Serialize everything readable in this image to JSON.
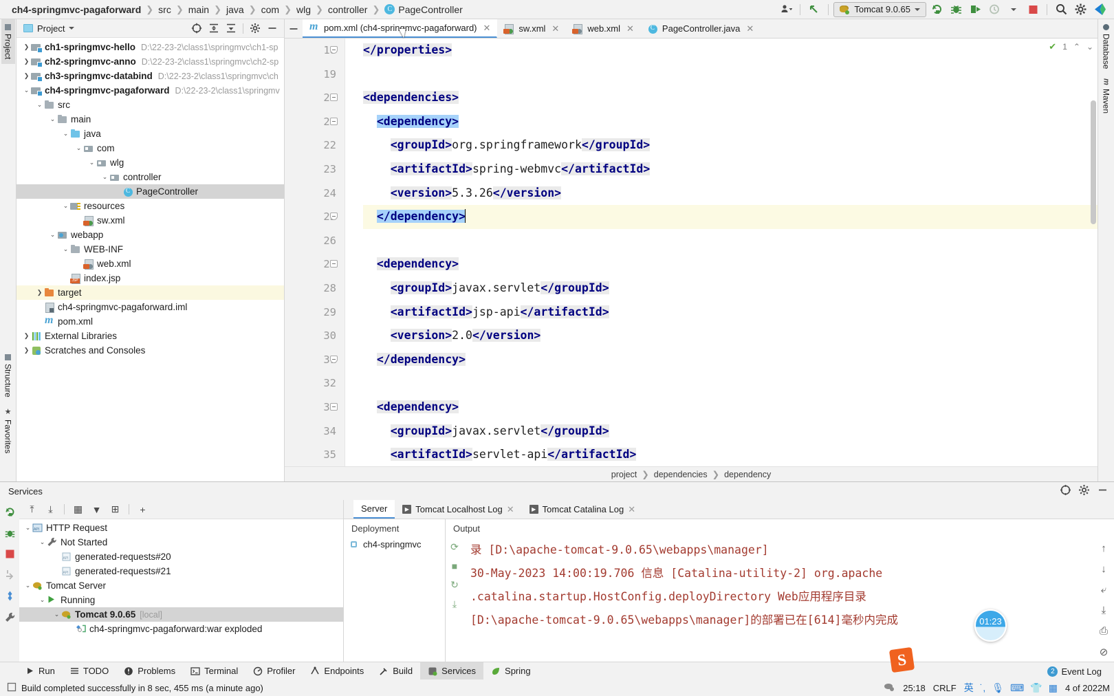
{
  "breadcrumb": {
    "project": "ch4-springmvc-pagaforward",
    "items": [
      "src",
      "main",
      "java",
      "com",
      "wlg",
      "controller"
    ],
    "classFile": "PageController",
    "class_icon": "class-c-icon"
  },
  "toolbar": {
    "profile_icon": "user-profile-icon",
    "updates_icon": "arrow-up-left-icon",
    "run_config": "Tomcat 9.0.65",
    "run_config_icon": "tomcat-icon",
    "dropdown_icon": "chevron-down-icon",
    "rerun_icon": "rerun-icon",
    "debug_icon": "debug-bug-icon",
    "run_with_coverage_icon": "run-with-coverage-icon",
    "profiler_icon": "profiler-clock-icon",
    "stop_icon": "stop-square-icon",
    "search_icon": "search-magnifier-icon",
    "settings_icon": "gear-icon",
    "ide_logo_icon": "intellij-logo-icon"
  },
  "left_strip": {
    "project_tab": "Project",
    "structure_tab": "Structure",
    "favorites_tab": "Favorites",
    "project_icon": "folder-icon",
    "structure_icon": "structure-icon",
    "favorites_icon": "star-icon"
  },
  "right_strip": {
    "database_tab": "Database",
    "maven_tab": "Maven",
    "database_icon": "database-icon",
    "maven_icon": "maven-m-icon"
  },
  "project_panel": {
    "title": "Project",
    "title_icon": "project-view-icon",
    "dropdown_icon": "chevron-down-icon",
    "actions": [
      {
        "name": "select-opened-file-icon",
        "glyph": "⊕"
      },
      {
        "name": "expand-all-icon",
        "glyph": "⤒"
      },
      {
        "name": "collapse-all-icon",
        "glyph": "⤓"
      },
      {
        "name": "settings-gear-icon",
        "glyph": "✿"
      },
      {
        "name": "hide-panel-icon",
        "glyph": "—"
      }
    ],
    "tree": [
      {
        "label": "ch1-springmvc-hello",
        "path": "D:\\22-23-2\\class1\\springmvc\\ch1-sp",
        "indent": 0,
        "arrow": "collapsed",
        "icon": "module-folder-icon",
        "bold": true
      },
      {
        "label": "ch2-springmvc-anno",
        "path": "D:\\22-23-2\\class1\\springmvc\\ch2-sp",
        "indent": 0,
        "arrow": "collapsed",
        "icon": "module-folder-icon",
        "bold": true
      },
      {
        "label": "ch3-springmvc-databind",
        "path": "D:\\22-23-2\\class1\\springmvc\\ch",
        "indent": 0,
        "arrow": "collapsed",
        "icon": "module-folder-icon",
        "bold": true
      },
      {
        "label": "ch4-springmvc-pagaforward",
        "path": "D:\\22-23-2\\class1\\springmv",
        "indent": 0,
        "arrow": "expanded",
        "icon": "module-folder-icon",
        "bold": true
      },
      {
        "label": "src",
        "path": "",
        "indent": 1,
        "arrow": "expanded",
        "icon": "folder-icon",
        "bold": false
      },
      {
        "label": "main",
        "path": "",
        "indent": 2,
        "arrow": "expanded",
        "icon": "folder-icon",
        "bold": false
      },
      {
        "label": "java",
        "path": "",
        "indent": 3,
        "arrow": "expanded",
        "icon": "source-root-icon",
        "bold": false
      },
      {
        "label": "com",
        "path": "",
        "indent": 4,
        "arrow": "expanded",
        "icon": "package-icon",
        "bold": false
      },
      {
        "label": "wlg",
        "path": "",
        "indent": 5,
        "arrow": "expanded",
        "icon": "package-icon",
        "bold": false
      },
      {
        "label": "controller",
        "path": "",
        "indent": 6,
        "arrow": "expanded",
        "icon": "package-icon",
        "bold": false
      },
      {
        "label": "PageController",
        "path": "",
        "indent": 7,
        "arrow": "none",
        "icon": "java-class-icon",
        "bold": false,
        "selected": true
      },
      {
        "label": "resources",
        "path": "",
        "indent": 3,
        "arrow": "expanded",
        "icon": "resources-root-icon",
        "bold": false
      },
      {
        "label": "sw.xml",
        "path": "",
        "indent": 4,
        "arrow": "none",
        "icon": "xml-file-icon",
        "bold": false
      },
      {
        "label": "webapp",
        "path": "",
        "indent": 2,
        "arrow": "expanded",
        "icon": "webapp-folder-icon",
        "bold": false
      },
      {
        "label": "WEB-INF",
        "path": "",
        "indent": 3,
        "arrow": "expanded",
        "icon": "folder-icon",
        "bold": false
      },
      {
        "label": "web.xml",
        "path": "",
        "indent": 4,
        "arrow": "none",
        "icon": "xml-file-icon",
        "bold": false
      },
      {
        "label": "index.jsp",
        "path": "",
        "indent": 3,
        "arrow": "none",
        "icon": "jsp-file-icon",
        "bold": false
      },
      {
        "label": "target",
        "path": "",
        "indent": 1,
        "arrow": "collapsed",
        "icon": "target-folder-icon",
        "bold": false,
        "highlight": true
      },
      {
        "label": "ch4-springmvc-pagaforward.iml",
        "path": "",
        "indent": 1,
        "arrow": "none",
        "icon": "iml-file-icon",
        "bold": false
      },
      {
        "label": "pom.xml",
        "path": "",
        "indent": 1,
        "arrow": "none",
        "icon": "maven-pom-icon",
        "bold": false
      },
      {
        "label": "External Libraries",
        "path": "",
        "indent": 0,
        "arrow": "collapsed",
        "icon": "libraries-icon",
        "bold": false
      },
      {
        "label": "Scratches and Consoles",
        "path": "",
        "indent": 0,
        "arrow": "collapsed",
        "icon": "scratches-icon",
        "bold": false
      }
    ]
  },
  "editor": {
    "collapse_icon": "hide-tabs-icon",
    "tabs": [
      {
        "label": "pom.xml (ch4-springmvc-pagaforward)",
        "icon": "maven-pom-icon",
        "active": true,
        "close_icon": "close-icon"
      },
      {
        "label": "sw.xml",
        "icon": "xml-file-icon",
        "active": false,
        "close_icon": "close-icon"
      },
      {
        "label": "web.xml",
        "icon": "xml-file-icon",
        "active": false,
        "close_icon": "close-icon"
      },
      {
        "label": "PageController.java",
        "icon": "java-class-icon",
        "active": false,
        "close_icon": "close-icon"
      }
    ],
    "inspection": {
      "count": "1",
      "check_icon": "inspection-check-icon",
      "prev_icon": "chevron-up-icon",
      "next_icon": "chevron-down-icon"
    },
    "first_line_number": 18,
    "lines": [
      {
        "num": 18,
        "indent": 0,
        "fold": "end",
        "current": false,
        "parts": [
          {
            "t": "</properties>",
            "k": "tag",
            "bg": "hl"
          }
        ]
      },
      {
        "num": 19,
        "indent": 0,
        "fold": "",
        "current": false,
        "parts": []
      },
      {
        "num": 20,
        "indent": 0,
        "fold": "start",
        "current": false,
        "parts": [
          {
            "t": "<dependencies>",
            "k": "tag",
            "bg": "hl"
          }
        ]
      },
      {
        "num": 21,
        "indent": 1,
        "fold": "start",
        "current": false,
        "parts": [
          {
            "t": "<dependency>",
            "k": "tag",
            "bg": "sel"
          }
        ]
      },
      {
        "num": 22,
        "indent": 2,
        "fold": "",
        "current": false,
        "parts": [
          {
            "t": "<groupId>",
            "k": "tag",
            "bg": "hl"
          },
          {
            "t": "org.springframework",
            "k": "txt",
            "bg": ""
          },
          {
            "t": "</groupId>",
            "k": "tag",
            "bg": "hl"
          }
        ]
      },
      {
        "num": 23,
        "indent": 2,
        "fold": "",
        "current": false,
        "parts": [
          {
            "t": "<artifactId>",
            "k": "tag",
            "bg": "hl"
          },
          {
            "t": "spring-webmvc",
            "k": "txt",
            "bg": ""
          },
          {
            "t": "</artifactId>",
            "k": "tag",
            "bg": "hl"
          }
        ]
      },
      {
        "num": 24,
        "indent": 2,
        "fold": "",
        "current": false,
        "parts": [
          {
            "t": "<version>",
            "k": "tag",
            "bg": "hl"
          },
          {
            "t": "5.3.26",
            "k": "txt",
            "bg": ""
          },
          {
            "t": "</version>",
            "k": "tag",
            "bg": "hl"
          }
        ]
      },
      {
        "num": 25,
        "indent": 1,
        "fold": "end",
        "current": true,
        "parts": [
          {
            "t": "</dependency>",
            "k": "tag",
            "bg": "sel"
          }
        ],
        "caret": true
      },
      {
        "num": 26,
        "indent": 0,
        "fold": "",
        "current": false,
        "parts": []
      },
      {
        "num": 27,
        "indent": 1,
        "fold": "start",
        "current": false,
        "parts": [
          {
            "t": "<dependency>",
            "k": "tag",
            "bg": "hl"
          }
        ]
      },
      {
        "num": 28,
        "indent": 2,
        "fold": "",
        "current": false,
        "parts": [
          {
            "t": "<groupId>",
            "k": "tag",
            "bg": "hl"
          },
          {
            "t": "javax.servlet",
            "k": "txt",
            "bg": ""
          },
          {
            "t": "</groupId>",
            "k": "tag",
            "bg": "hl"
          }
        ]
      },
      {
        "num": 29,
        "indent": 2,
        "fold": "",
        "current": false,
        "parts": [
          {
            "t": "<artifactId>",
            "k": "tag",
            "bg": "hl"
          },
          {
            "t": "jsp-api",
            "k": "txt",
            "bg": ""
          },
          {
            "t": "</artifactId>",
            "k": "tag",
            "bg": "hl"
          }
        ]
      },
      {
        "num": 30,
        "indent": 2,
        "fold": "",
        "current": false,
        "parts": [
          {
            "t": "<version>",
            "k": "tag",
            "bg": "hl"
          },
          {
            "t": "2.0",
            "k": "txt",
            "bg": ""
          },
          {
            "t": "</version>",
            "k": "tag",
            "bg": "hl"
          }
        ]
      },
      {
        "num": 31,
        "indent": 1,
        "fold": "end",
        "current": false,
        "parts": [
          {
            "t": "</dependency>",
            "k": "tag",
            "bg": "hl"
          }
        ]
      },
      {
        "num": 32,
        "indent": 0,
        "fold": "",
        "current": false,
        "parts": []
      },
      {
        "num": 33,
        "indent": 1,
        "fold": "start",
        "current": false,
        "parts": [
          {
            "t": "<dependency>",
            "k": "tag",
            "bg": "hl"
          }
        ]
      },
      {
        "num": 34,
        "indent": 2,
        "fold": "",
        "current": false,
        "parts": [
          {
            "t": "<groupId>",
            "k": "tag",
            "bg": "hl"
          },
          {
            "t": "javax.servlet",
            "k": "txt",
            "bg": ""
          },
          {
            "t": "</groupId>",
            "k": "tag",
            "bg": "hl"
          }
        ]
      },
      {
        "num": 35,
        "indent": 2,
        "fold": "",
        "current": false,
        "parts": [
          {
            "t": "<artifactId>",
            "k": "tag",
            "bg": "hl"
          },
          {
            "t": "servlet-api",
            "k": "txt",
            "bg": ""
          },
          {
            "t": "</artifactId>",
            "k": "tag",
            "bg": "hl"
          }
        ]
      }
    ],
    "crumbs": [
      "project",
      "dependencies",
      "dependency"
    ]
  },
  "services": {
    "title": "Services",
    "header_actions": [
      {
        "name": "services-settings-icon",
        "glyph": "⊕"
      },
      {
        "name": "gear-icon",
        "glyph": "✿"
      },
      {
        "name": "hide-panel-icon",
        "glyph": "—"
      }
    ],
    "side_tools": [
      {
        "name": "rerun-service-icon"
      },
      {
        "name": "debug-service-icon"
      },
      {
        "name": "stop-service-icon"
      },
      {
        "name": "redeploy-icon"
      },
      {
        "name": "edit-configuration-icon"
      },
      {
        "name": "settings-wrench-icon"
      }
    ],
    "tree_toolbar": [
      {
        "name": "expand-all-icon",
        "glyph": "⤒"
      },
      {
        "name": "collapse-all-icon",
        "glyph": "⤓"
      },
      {
        "name": "group-by-icon",
        "glyph": "▦"
      },
      {
        "name": "filter-icon",
        "glyph": "▼"
      },
      {
        "name": "show-services-icon",
        "glyph": "⊞"
      },
      {
        "name": "add-service-icon",
        "glyph": "+"
      }
    ],
    "tree": [
      {
        "label": "HTTP Request",
        "indent": 0,
        "arrow": "expanded",
        "icon": "http-request-api-icon",
        "bold": false
      },
      {
        "label": "Not Started",
        "indent": 1,
        "arrow": "expanded",
        "icon": "wrench-icon",
        "bold": false
      },
      {
        "label": "generated-requests#20",
        "indent": 2,
        "arrow": "none",
        "icon": "api-file-icon",
        "bold": false
      },
      {
        "label": "generated-requests#21",
        "indent": 2,
        "arrow": "none",
        "icon": "api-file-icon",
        "bold": false
      },
      {
        "label": "Tomcat Server",
        "indent": 0,
        "arrow": "expanded",
        "icon": "tomcat-icon",
        "bold": false
      },
      {
        "label": "Running",
        "indent": 1,
        "arrow": "expanded",
        "icon": "run-green-arrow-icon",
        "bold": false
      },
      {
        "label": "Tomcat 9.0.65",
        "suffix": "[local]",
        "indent": 2,
        "arrow": "expanded",
        "icon": "tomcat-icon",
        "bold": true,
        "selected": true
      },
      {
        "label": "ch4-springmvc-pagaforward:war exploded",
        "indent": 3,
        "arrow": "none",
        "icon": "artifact-icon",
        "bold": false
      }
    ],
    "tabs": [
      {
        "label": "Server",
        "active": true,
        "icon": "",
        "close": false
      },
      {
        "label": "Tomcat Localhost Log",
        "active": false,
        "icon": "console-icon",
        "close": true
      },
      {
        "label": "Tomcat Catalina Log",
        "active": false,
        "icon": "console-icon",
        "close": true
      }
    ],
    "deployment_header": "Deployment",
    "deployment_items": [
      {
        "label": "ch4-springmvc",
        "icon": "artifact-icon",
        "action_icon": "deploy-icon"
      }
    ],
    "output_header": "Output",
    "output_lines": [
      "录 [D:\\apache-tomcat-9.0.65\\webapps\\manager]",
      "30-May-2023 14:00:19.706 信息 [Catalina-utility-2] org.apache",
      ".catalina.startup.HostConfig.deployDirectory Web应用程序目录",
      "[D:\\apache-tomcat-9.0.65\\webapps\\manager]的部署已在[614]毫秒内完成"
    ],
    "output_tools": [
      {
        "name": "scroll-up-icon",
        "glyph": "↑"
      },
      {
        "name": "scroll-down-icon",
        "glyph": "↓"
      },
      {
        "name": "soft-wrap-icon",
        "glyph": "⤶"
      },
      {
        "name": "scroll-to-end-icon",
        "glyph": "⤓"
      },
      {
        "name": "print-icon",
        "glyph": "⎙"
      },
      {
        "name": "clear-all-icon",
        "glyph": "⊘"
      }
    ],
    "left_output_tools": [
      {
        "name": "rerun-icon",
        "glyph": "⟳"
      },
      {
        "name": "stop-icon",
        "glyph": "■"
      },
      {
        "name": "restart-icon",
        "glyph": "↻"
      },
      {
        "name": "deploy-all-icon",
        "glyph": "⤓"
      }
    ]
  },
  "bottom_bar": {
    "windows": [
      {
        "label": "Run",
        "icon": "run-arrow-icon",
        "active": false
      },
      {
        "label": "TODO",
        "icon": "todo-list-icon",
        "active": false
      },
      {
        "label": "Problems",
        "icon": "problems-icon",
        "active": false
      },
      {
        "label": "Terminal",
        "icon": "terminal-icon",
        "active": false
      },
      {
        "label": "Profiler",
        "icon": "profiler-icon",
        "active": false
      },
      {
        "label": "Endpoints",
        "icon": "endpoints-icon",
        "active": false
      },
      {
        "label": "Build",
        "icon": "build-hammer-icon",
        "active": false
      },
      {
        "label": "Services",
        "icon": "services-icon",
        "active": true
      },
      {
        "label": "Spring",
        "icon": "spring-leaf-icon",
        "active": false
      }
    ]
  },
  "status_bar": {
    "build_icon": "build-status-icon",
    "message": "Build completed successfully in 8 sec, 455 ms (a minute ago)",
    "caret_position": "25:18",
    "line_separator": "CRLF",
    "memory": "4 of 2022M",
    "memory_icon": "memory-indicator-icon",
    "notification_icon": "notification-gear-icon",
    "ime": {
      "logo": "S",
      "lang": "英",
      "punctuation_icon": "punctuation-icon",
      "voice_icon": "microphone-icon",
      "keyboard_icon": "soft-keyboard-icon",
      "skin_icon": "skin-tshirt-icon",
      "toolbox_icon": "toolbox-grid-icon"
    }
  },
  "event_log": {
    "label": "Event Log",
    "badge": "2"
  },
  "floating": {
    "timer": "01:23"
  },
  "colors": {
    "accent": "#4a8fd4",
    "selection": "#a6d2fa",
    "tag": "#000080",
    "log_text": "#a33b30",
    "current_line": "#fcfae3",
    "tree_selected": "#d4d4d4"
  }
}
